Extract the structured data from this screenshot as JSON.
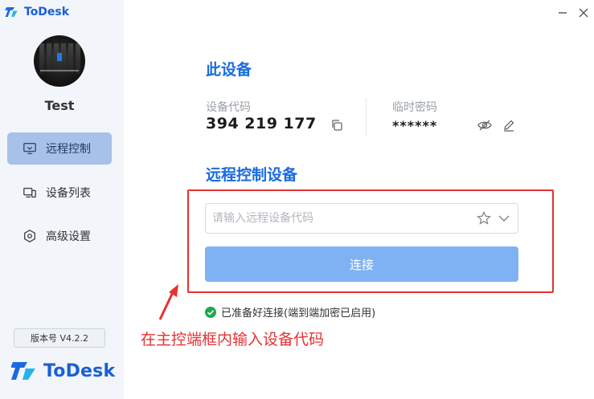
{
  "window": {
    "app_name": "ToDesk",
    "minimize_icon": "minimize-icon",
    "close_icon": "close-icon"
  },
  "sidebar": {
    "username": "Test",
    "items": [
      {
        "label": "远程控制",
        "icon": "monitor-remote-icon",
        "active": true
      },
      {
        "label": "设备列表",
        "icon": "devices-icon",
        "active": false
      },
      {
        "label": "高级设置",
        "icon": "settings-hexagon-icon",
        "active": false
      }
    ],
    "version": "版本号 V4.2.2",
    "brand": "ToDesk"
  },
  "this_device": {
    "title": "此设备",
    "code_label": "设备代码",
    "code_value": "394 219 177",
    "pass_label": "临时密码",
    "pass_value": "******"
  },
  "remote": {
    "title": "远程控制设备",
    "input_placeholder": "请输入远程设备代码",
    "input_value": "",
    "connect_label": "连接"
  },
  "status": {
    "text": "已准备好连接(端到端加密已启用)"
  },
  "annotation": {
    "text": "在主控端框内输入设备代码",
    "color": "#e63232"
  },
  "colors": {
    "accent": "#1a6be0",
    "sidebar_active": "#a7c1e8",
    "button": "#7fb2f3",
    "success": "#1fa84f"
  }
}
